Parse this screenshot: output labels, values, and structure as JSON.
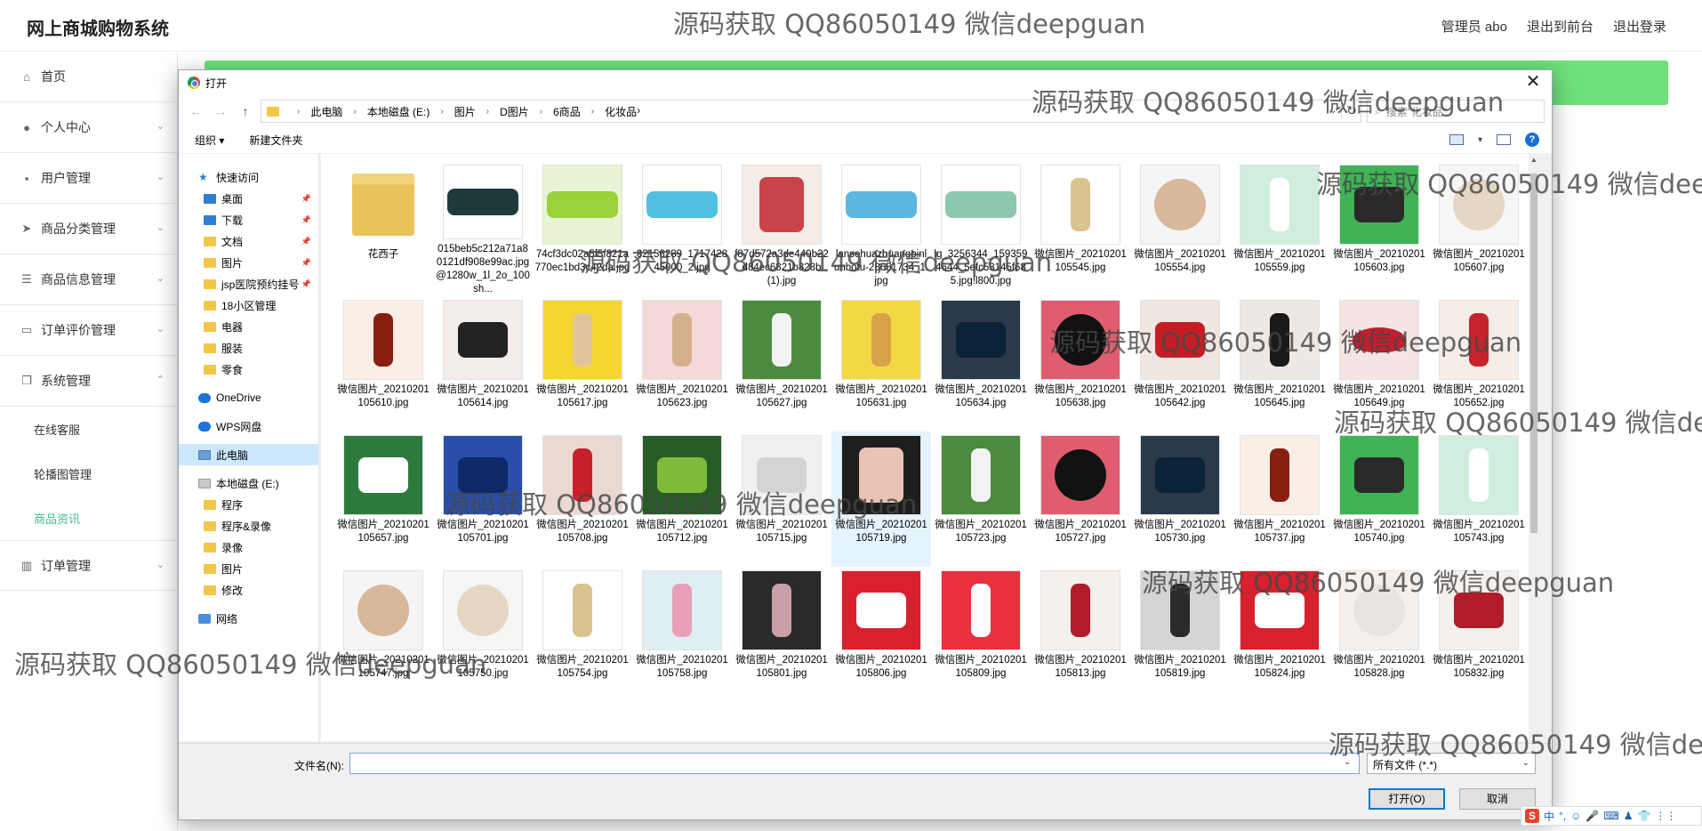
{
  "app": {
    "title": "网上商城购物系统",
    "header_links": [
      "管理员 abo",
      "退出到前台",
      "退出登录"
    ]
  },
  "sidebar": {
    "items": [
      {
        "label": "首页",
        "icon": "home-icon",
        "glyph": "⌂",
        "arrow": ""
      },
      {
        "label": "个人中心",
        "icon": "user-icon",
        "glyph": "●",
        "arrow": "⌄"
      },
      {
        "label": "用户管理",
        "icon": "user-manage-icon",
        "glyph": "▪",
        "arrow": "⌄"
      },
      {
        "label": "商品分类管理",
        "icon": "send-icon",
        "glyph": "➤",
        "arrow": "⌄"
      },
      {
        "label": "商品信息管理",
        "icon": "list-icon",
        "glyph": "☰",
        "arrow": "⌄"
      },
      {
        "label": "订单评价管理",
        "icon": "monitor-icon",
        "glyph": "▭",
        "arrow": "⌄"
      },
      {
        "label": "系统管理",
        "icon": "copy-icon",
        "glyph": "❐",
        "arrow": "⌃"
      }
    ],
    "sub_items": [
      {
        "label": "在线客服",
        "active": false
      },
      {
        "label": "轮播图管理",
        "active": false
      },
      {
        "label": "商品资讯",
        "active": true
      }
    ],
    "last_item": {
      "label": "订单管理",
      "icon": "order-icon",
      "glyph": "▥",
      "arrow": "⌄"
    }
  },
  "dialog": {
    "title": "打开",
    "close": "✕",
    "nav": {
      "back": "←",
      "forward": "→",
      "up": "↑"
    },
    "breadcrumb": [
      "此电脑",
      "本地磁盘 (E:)",
      "图片",
      "D图片",
      "6商品",
      "化妆品"
    ],
    "search_placeholder": "搜索\"化妆品\"",
    "toolbar": {
      "organize": "组织 ▾",
      "new_folder": "新建文件夹"
    },
    "nav_pane": [
      {
        "label": "快速访问",
        "kind": "star",
        "level": 0,
        "pin": false
      },
      {
        "label": "桌面",
        "kind": "blue",
        "level": 1,
        "pin": true
      },
      {
        "label": "下载",
        "kind": "blue",
        "level": 1,
        "pin": true
      },
      {
        "label": "文档",
        "kind": "folder",
        "level": 1,
        "pin": true
      },
      {
        "label": "图片",
        "kind": "folder",
        "level": 1,
        "pin": true
      },
      {
        "label": "jsp医院预约挂号",
        "kind": "folder",
        "level": 1,
        "pin": true
      },
      {
        "label": "18小区管理",
        "kind": "folder",
        "level": 1,
        "pin": false
      },
      {
        "label": "电器",
        "kind": "folder",
        "level": 1,
        "pin": false
      },
      {
        "label": "服装",
        "kind": "folder",
        "level": 1,
        "pin": false
      },
      {
        "label": "零食",
        "kind": "folder",
        "level": 1,
        "pin": false
      },
      {
        "label": "",
        "kind": "gap",
        "level": 0,
        "pin": false
      },
      {
        "label": "OneDrive",
        "kind": "cloud",
        "level": 0,
        "pin": false
      },
      {
        "label": "",
        "kind": "gap",
        "level": 0,
        "pin": false
      },
      {
        "label": "WPS网盘",
        "kind": "cloud",
        "level": 0,
        "pin": false
      },
      {
        "label": "",
        "kind": "gap",
        "level": 0,
        "pin": false
      },
      {
        "label": "此电脑",
        "kind": "pc",
        "level": 0,
        "pin": false,
        "selected": true
      },
      {
        "label": "",
        "kind": "gap",
        "level": 0,
        "pin": false
      },
      {
        "label": "本地磁盘 (E:)",
        "kind": "drive",
        "level": 0,
        "pin": false
      },
      {
        "label": "程序",
        "kind": "folder",
        "level": 1,
        "pin": false
      },
      {
        "label": "程序&录像",
        "kind": "folder",
        "level": 1,
        "pin": false
      },
      {
        "label": "录像",
        "kind": "folder",
        "level": 1,
        "pin": false
      },
      {
        "label": "图片",
        "kind": "folder",
        "level": 1,
        "pin": false
      },
      {
        "label": "修改",
        "kind": "folder",
        "level": 1,
        "pin": false
      },
      {
        "label": "",
        "kind": "gap",
        "level": 0,
        "pin": false
      },
      {
        "label": "网络",
        "kind": "net",
        "level": 0,
        "pin": false
      }
    ],
    "files": [
      {
        "name": "花西子",
        "bg": "#f2d27a",
        "fg": "#3a6f8f",
        "shape": "folder"
      },
      {
        "name": "015beb5c212a71a80121df908e99ac.jpg@1280w_1l_2o_100sh...",
        "bg": "#ffffff",
        "fg": "#1f3a3a",
        "shape": "wide"
      },
      {
        "name": "74cf3dc02a5f5f821a770ec1bd3c42da.jpg",
        "bg": "#e8f4d4",
        "fg": "#9bd13a",
        "shape": "wide"
      },
      {
        "name": "82156289_171742845000_2.jpg",
        "bg": "#ffffff",
        "fg": "#4fc0e0",
        "shape": "wide"
      },
      {
        "name": "f87d572a3de440b22d84ec6821b828b (1).jpg",
        "bg": "#f4ece6",
        "fg": "#c8444a",
        "shape": "face"
      },
      {
        "name": "lansehuazhuangpinlunbotu-28651734_1.jpg",
        "bg": "#ffffff",
        "fg": "#5ab8e0",
        "shape": "wide"
      },
      {
        "name": "lg_3256344_1593594644_5efc53145f685.jpg!l800.jpg",
        "bg": "#ffffff",
        "fg": "#8cc8b0",
        "shape": "wide"
      },
      {
        "name": "微信图片_20210201105545.jpg",
        "bg": "#ffffff",
        "fg": "#d9c490",
        "shape": "bottle"
      },
      {
        "name": "微信图片_20210201105554.jpg",
        "bg": "#f5f5f5",
        "fg": "#d8b79a",
        "shape": "compact"
      },
      {
        "name": "微信图片_20210201105559.jpg",
        "bg": "#cfeedd",
        "fg": "#ffffff",
        "shape": "bottle"
      },
      {
        "name": "微信图片_20210201105603.jpg",
        "bg": "#3fb356",
        "fg": "#2a2a2a",
        "shape": "jar"
      },
      {
        "name": "微信图片_20210201105607.jpg",
        "bg": "#f6f6f6",
        "fg": "#e6d7c4",
        "shape": "compact"
      },
      {
        "name": "微信图片_20210201105610.jpg",
        "bg": "#fbeee6",
        "fg": "#8a1e12",
        "shape": "bottle"
      },
      {
        "name": "微信图片_20210201105614.jpg",
        "bg": "#f2ecea",
        "fg": "#222222",
        "shape": "jar"
      },
      {
        "name": "微信图片_20210201105617.jpg",
        "bg": "#f5d630",
        "fg": "#e0c49c",
        "shape": "bottle"
      },
      {
        "name": "微信图片_20210201105623.jpg",
        "bg": "#f4d9d9",
        "fg": "#d4b08c",
        "shape": "bottle"
      },
      {
        "name": "微信图片_20210201105627.jpg",
        "bg": "#4c8a3e",
        "fg": "#f2f2f2",
        "shape": "bottle"
      },
      {
        "name": "微信图片_20210201105631.jpg",
        "bg": "#f3d845",
        "fg": "#d8a24a",
        "shape": "bottle"
      },
      {
        "name": "微信图片_20210201105634.jpg",
        "bg": "#2a3a4a",
        "fg": "#0c2238",
        "shape": "jar"
      },
      {
        "name": "微信图片_20210201105638.jpg",
        "bg": "#e05d70",
        "fg": "#111111",
        "shape": "compact"
      },
      {
        "name": "微信图片_20210201105642.jpg",
        "bg": "#f0e6e2",
        "fg": "#c41e24",
        "shape": "jar"
      },
      {
        "name": "微信图片_20210201105645.jpg",
        "bg": "#ece8e4",
        "fg": "#1a1a1a",
        "shape": "bottle"
      },
      {
        "name": "微信图片_20210201105649.jpg",
        "bg": "#f4e4e4",
        "fg": "#c01f2f",
        "shape": "lips"
      },
      {
        "name": "微信图片_20210201105652.jpg",
        "bg": "#f4ede8",
        "fg": "#c5242d",
        "shape": "bottle"
      },
      {
        "name": "微信图片_20210201105657.jpg",
        "bg": "#2e7a3e",
        "fg": "#ffffff",
        "shape": "jar"
      },
      {
        "name": "微信图片_20210201105701.jpg",
        "bg": "#2a4ea8",
        "fg": "#0e2a6a",
        "shape": "jar"
      },
      {
        "name": "微信图片_20210201105708.jpg",
        "bg": "#ead8d2",
        "fg": "#c8202a",
        "shape": "bottle"
      },
      {
        "name": "微信图片_20210201105712.jpg",
        "bg": "#285c26",
        "fg": "#7dbb3a",
        "shape": "jar"
      },
      {
        "name": "微信图片_20210201105715.jpg",
        "bg": "#f0f0f0",
        "fg": "#d4d4d4",
        "shape": "jar"
      },
      {
        "name": "微信图片_20210201105719.jpg",
        "bg": "#1e1e1e",
        "fg": "#e9c4b4",
        "shape": "face",
        "selected": true
      },
      {
        "name": "微信图片_20210201105723.jpg",
        "bg": "#4c8a3e",
        "fg": "#f2f2f2",
        "shape": "bottle"
      },
      {
        "name": "微信图片_20210201105727.jpg",
        "bg": "#e05d70",
        "fg": "#111111",
        "shape": "compact"
      },
      {
        "name": "微信图片_20210201105730.jpg",
        "bg": "#2a3a4a",
        "fg": "#0c2238",
        "shape": "jar"
      },
      {
        "name": "微信图片_20210201105737.jpg",
        "bg": "#fbeee6",
        "fg": "#8a1e12",
        "shape": "bottle"
      },
      {
        "name": "微信图片_20210201105740.jpg",
        "bg": "#3fb356",
        "fg": "#2a2a2a",
        "shape": "jar"
      },
      {
        "name": "微信图片_20210201105743.jpg",
        "bg": "#cfeedd",
        "fg": "#ffffff",
        "shape": "bottle"
      },
      {
        "name": "微信图片_20210201105747.jpg",
        "bg": "#f5f5f5",
        "fg": "#d8b79a",
        "shape": "compact"
      },
      {
        "name": "微信图片_20210201105750.jpg",
        "bg": "#f6f6f6",
        "fg": "#e6d7c4",
        "shape": "compact"
      },
      {
        "name": "微信图片_20210201105754.jpg",
        "bg": "#ffffff",
        "fg": "#d9c490",
        "shape": "bottle"
      },
      {
        "name": "微信图片_20210201105758.jpg",
        "bg": "#dfeef2",
        "fg": "#e8a0b8",
        "shape": "bottle"
      },
      {
        "name": "微信图片_20210201105801.jpg",
        "bg": "#2a2a2a",
        "fg": "#c9a0a8",
        "shape": "bottle"
      },
      {
        "name": "微信图片_20210201105806.jpg",
        "bg": "#d8202e",
        "fg": "#ffffff",
        "shape": "jar"
      },
      {
        "name": "微信图片_20210201105809.jpg",
        "bg": "#e8303e",
        "fg": "#ffffff",
        "shape": "bottle"
      },
      {
        "name": "微信图片_20210201105813.jpg",
        "bg": "#f4f0ee",
        "fg": "#b01c28",
        "shape": "bottle"
      },
      {
        "name": "微信图片_20210201105819.jpg",
        "bg": "#d4d4d4",
        "fg": "#2a2a2a",
        "shape": "bottle"
      },
      {
        "name": "微信图片_20210201105824.jpg",
        "bg": "#d8202e",
        "fg": "#ffffff",
        "shape": "jar"
      },
      {
        "name": "微信图片_20210201105828.jpg",
        "bg": "#f6f0ec",
        "fg": "#e8e4e0",
        "shape": "compact"
      },
      {
        "name": "微信图片_20210201105832.jpg",
        "bg": "#f4f0ee",
        "fg": "#b01c28",
        "shape": "jar"
      }
    ],
    "bottom": {
      "filename_label": "文件名(N):",
      "filename_value": "",
      "filetype": "所有文件 (*.*)",
      "open": "打开(O)",
      "cancel": "取消"
    }
  },
  "watermark": "源码获取 QQ86050149 微信deepguan",
  "ime": [
    "S",
    "中",
    "°,",
    "☺",
    "🎤",
    "⌨",
    "♟",
    "👕",
    "⋮⋮"
  ]
}
